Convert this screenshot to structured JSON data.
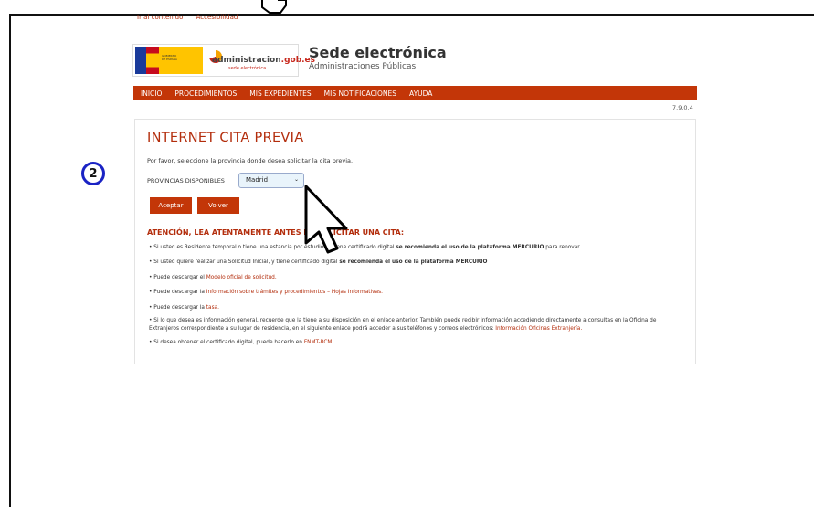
{
  "skip_links": [
    "Ir al contenido",
    "Accesibilidad"
  ],
  "logo": {
    "gov_lines": [
      "GOBIERNO",
      "DE ESPAÑA"
    ],
    "name_main": "administracion",
    "name_domain": ".gob.es",
    "name_sub": "sede electrónica"
  },
  "site": {
    "title": "Sede electrónica",
    "subtitle": "Administraciones Públicas"
  },
  "nav": [
    "INICIO",
    "PROCEDIMIENTOS",
    "MIS EXPEDIENTES",
    "MIS NOTIFICACIONES",
    "AYUDA"
  ],
  "version": "7.9.0.4",
  "page": {
    "title": "INTERNET CITA PREVIA",
    "instruction": "Por favor, seleccione la provincia donde desea solicitar la cita previa.",
    "province_label": "PROVINCIAS DISPONIBLES",
    "province_value": "Madrid",
    "accept": "Aceptar",
    "back": "Volver",
    "attention": "ATENCIÓN, LEA ATENTAMENTE ANTES DE SOLICITAR UNA CITA:"
  },
  "bullets": {
    "b1_a": "• Si usted es Residente temporal o tiene una estancia por estudios y tiene certificado digital ",
    "b1_b": "se recomienda el uso de la plataforma ",
    "b1_c": "MERCURIO",
    "b1_d": " para renovar.",
    "b2_a": "• Si usted quiere realizar una Solicitud Inicial, y tiene certificado digital ",
    "b2_b": "se recomienda el uso de la plataforma ",
    "b2_c": "MERCURIO",
    "b3_a": "• Puede descargar el ",
    "b3_b": "Modelo oficial de solicitud.",
    "b4_a": "• Puede descargar la ",
    "b4_b": "Información sobre trámites y procedimientos – Hojas Informativas.",
    "b5_a": "• Puede descargar la ",
    "b5_b": "tasa.",
    "b6_a": "• Si lo que desea es información general, recuerde que la tiene a su disposición en el enlace anterior. También puede recibir información accediendo directamente a consultas en la Oficina de Extranjeros correspondiente a su lugar de residencia, en el siguiente enlace podrá acceder a sus teléfonos y correos electrónicos: ",
    "b6_b": "Información Oficinas Extranjería.",
    "b7_a": "• Si desea obtener el certificado digital, puede hacerlo en ",
    "b7_b": "FNMT-RCM."
  },
  "step_number": "2",
  "colors": {
    "brand": "#c33608",
    "link": "#b32d0c",
    "badge": "#1a23c4"
  }
}
